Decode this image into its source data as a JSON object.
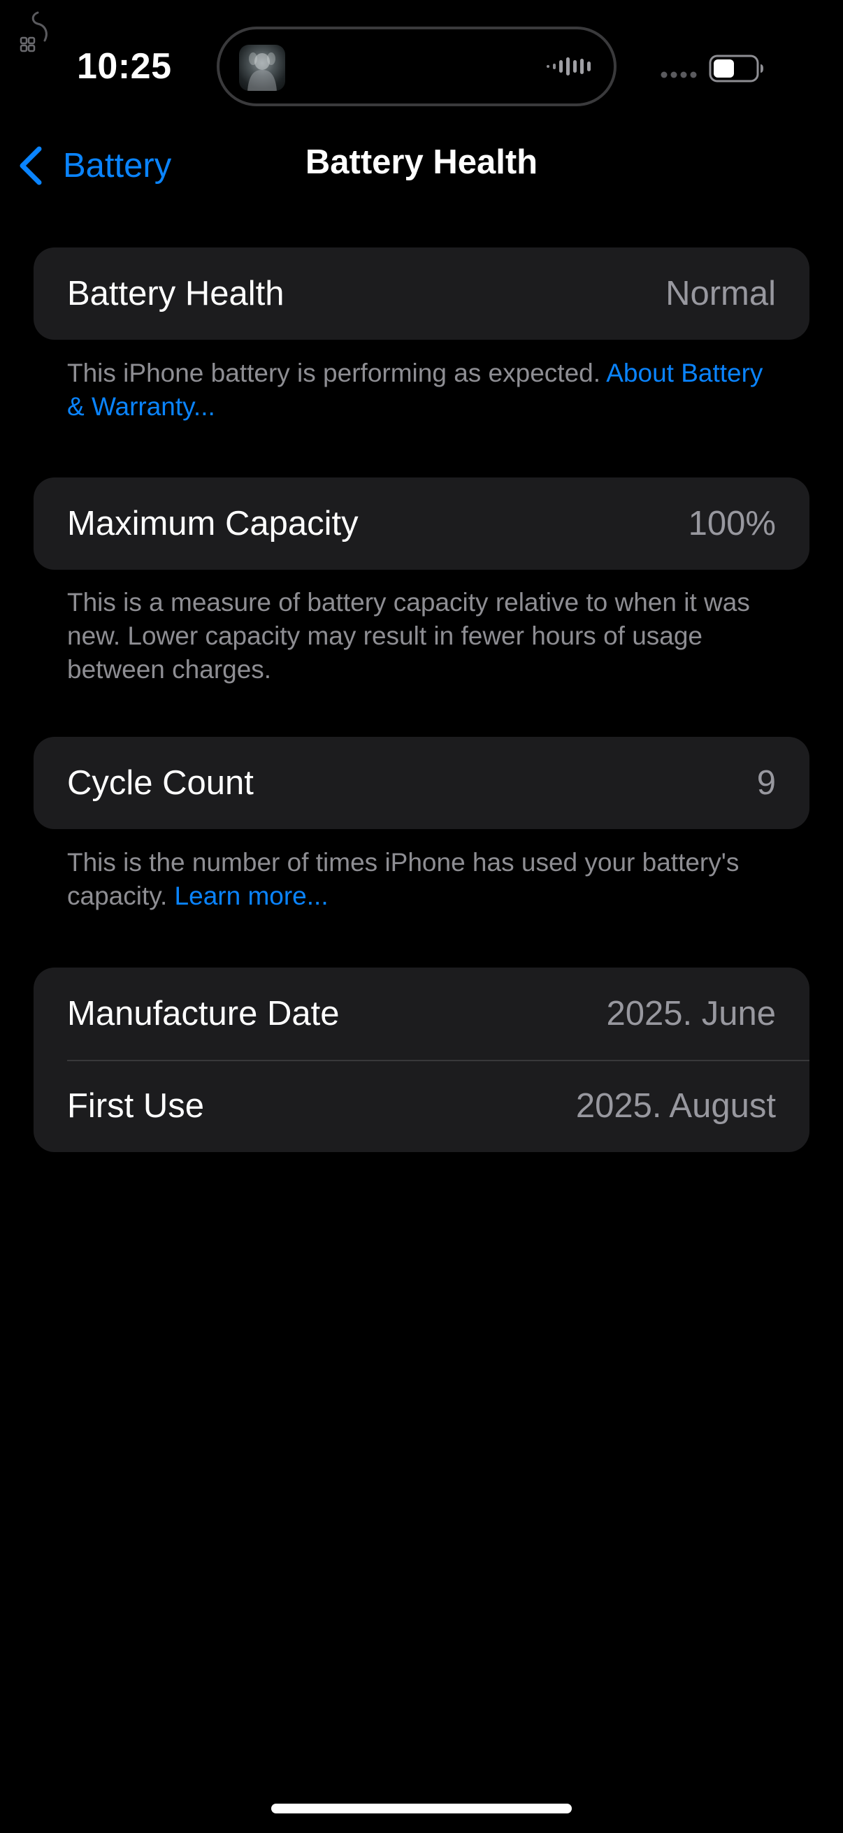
{
  "status_bar": {
    "time": "10:25",
    "assistive_icon": "assistive-touch-icon",
    "island_art_icon": "album-art-icon",
    "island_wave_icon": "audio-waveform-icon",
    "cellular_icon": "cellular-dots-icon",
    "battery_icon": "battery-icon",
    "battery_level": 0.5
  },
  "nav": {
    "back_label": "Battery",
    "back_icon": "chevron-left-icon",
    "title": "Battery Health"
  },
  "sections": {
    "health": {
      "label": "Battery Health",
      "value": "Normal",
      "footer_text": "This iPhone battery is performing as expected. ",
      "footer_link": "About Battery & Warranty..."
    },
    "capacity": {
      "label": "Maximum Capacity",
      "value": "100%",
      "footer_text": "This is a measure of battery capacity relative to when it was new. Lower capacity may result in fewer hours of usage between charges."
    },
    "cycles": {
      "label": "Cycle Count",
      "value": "9",
      "footer_text": "This is the number of times iPhone has used your battery's capacity. ",
      "footer_link": "Learn more..."
    },
    "dates": {
      "manufacture_label": "Manufacture Date",
      "manufacture_value": "2025. June",
      "first_use_label": "First Use",
      "first_use_value": "2025. August"
    }
  },
  "colors": {
    "background": "#000000",
    "cell_background": "#1c1c1e",
    "accent": "#0a84ff",
    "secondary_text": "#98989f"
  }
}
